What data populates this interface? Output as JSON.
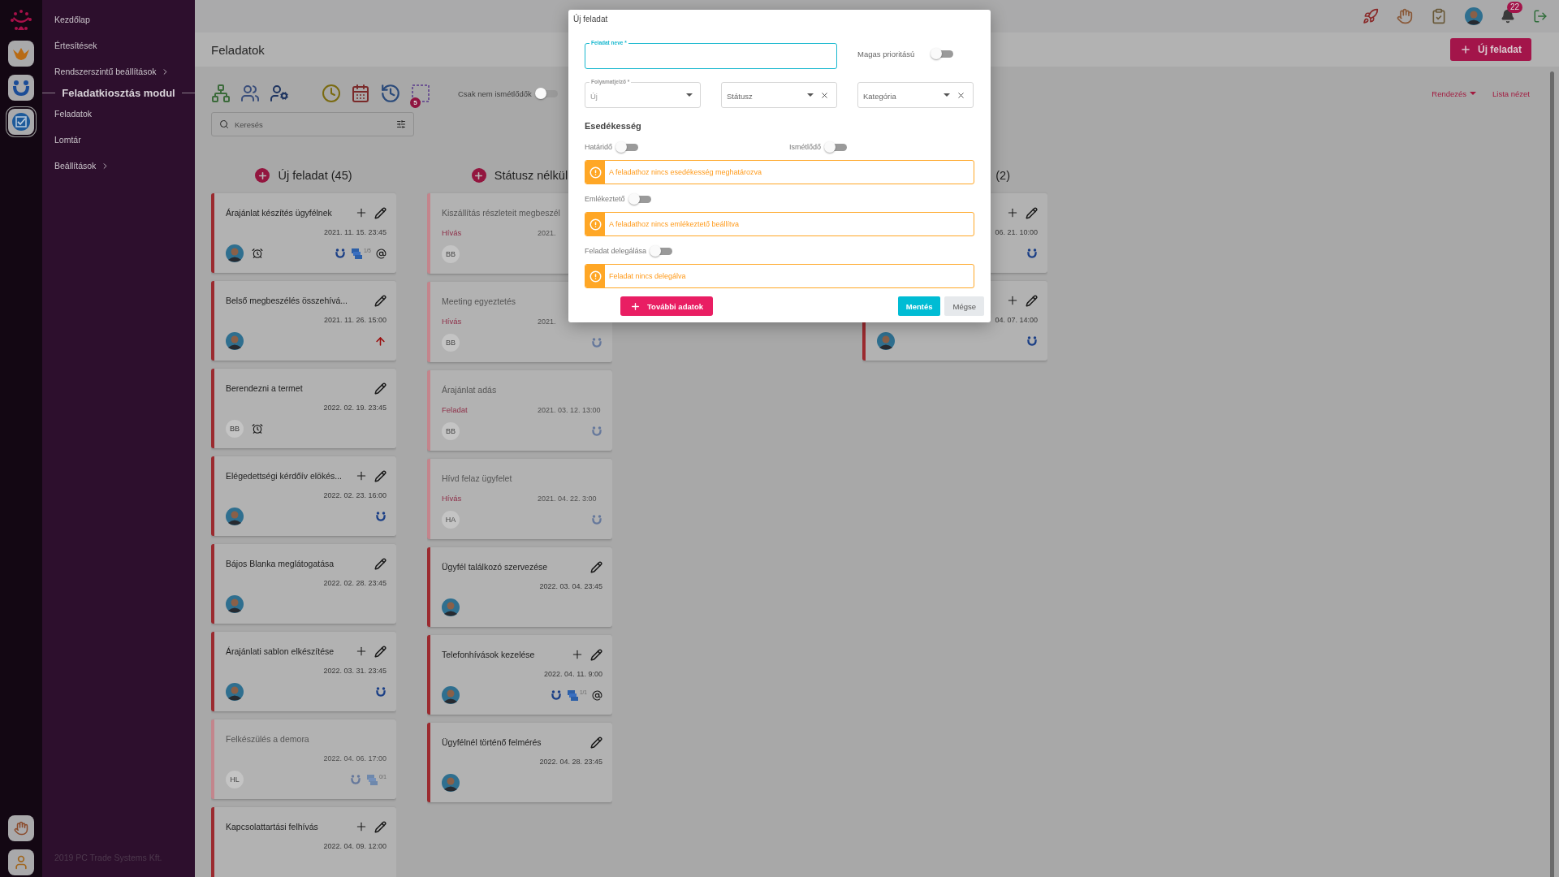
{
  "rail": {
    "apps": [
      {
        "kind": "crown",
        "selected": false
      },
      {
        "kind": "people",
        "selected": false
      },
      {
        "kind": "checkbox",
        "selected": true
      }
    ]
  },
  "sidebar": {
    "items": [
      {
        "kind": "link",
        "label": "Kezdőlap",
        "expandable": false
      },
      {
        "kind": "link",
        "label": "Értesítések",
        "expandable": false
      },
      {
        "kind": "link",
        "label": "Rendszerszintű beállítások",
        "expandable": true
      },
      {
        "kind": "section",
        "label": "Feladatkiosztás modul"
      },
      {
        "kind": "link",
        "label": "Feladatok",
        "expandable": false
      },
      {
        "kind": "link",
        "label": "Lomtár",
        "expandable": false
      },
      {
        "kind": "link",
        "label": "Beállítások",
        "expandable": true
      }
    ],
    "footer": "2019 PC Trade Systems Kft."
  },
  "top_bar": {
    "notification_count": "22"
  },
  "header": {
    "title": "Feladatok",
    "new_button": "Új feladat"
  },
  "filters": {
    "only_non_recurring": {
      "label": "Csak nem ismétlődők",
      "on": false
    },
    "search": {
      "placeholder": "Keresés",
      "filter_count": "5"
    },
    "sort_link": "Rendezés",
    "list_view_link": "Lista nézet"
  },
  "board": {
    "columns": [
      {
        "title": "Új feladat (45)",
        "cards": [
          {
            "title": "Árajánlat készítés ügyfélnek",
            "can_add": true,
            "editable": true,
            "faded": false,
            "date": "2021. 11. 15. 23:45",
            "avatar": {
              "kind": "photo"
            },
            "reminder": true,
            "high_priority": false,
            "badges": [
              {
                "kind": "people"
              },
              {
                "kind": "documents",
                "count": "1/5"
              },
              {
                "kind": "mention"
              }
            ]
          },
          {
            "title": "Belső megbeszélés összehívá...",
            "can_add": false,
            "editable": true,
            "faded": false,
            "date": "2021. 11. 26. 15:00",
            "avatar": {
              "kind": "photo"
            },
            "reminder": false,
            "high_priority": true
          },
          {
            "title": "Berendezni a termet",
            "can_add": false,
            "editable": true,
            "faded": false,
            "date": "2022. 02. 19. 23:45",
            "avatar": {
              "kind": "initials",
              "text": "BB"
            },
            "reminder": true,
            "high_priority": false
          },
          {
            "title": "Elégedettségi kérdőív elökés...",
            "can_add": true,
            "editable": true,
            "faded": false,
            "date": "2022. 02. 23. 16:00",
            "avatar": {
              "kind": "photo"
            },
            "reminder": false,
            "high_priority": false,
            "badges": [
              {
                "kind": "people"
              }
            ]
          },
          {
            "title": "Bájos Blanka meglátogatása",
            "can_add": false,
            "editable": true,
            "faded": false,
            "date": "2022. 02. 28. 23:45",
            "avatar": {
              "kind": "photo"
            },
            "reminder": false,
            "high_priority": false
          },
          {
            "title": "Árajánlati sablon elkészítése",
            "can_add": true,
            "editable": true,
            "faded": false,
            "date": "2022. 03. 31. 23:45",
            "avatar": {
              "kind": "photo"
            },
            "reminder": false,
            "high_priority": false,
            "badges": [
              {
                "kind": "people"
              }
            ]
          },
          {
            "title": "Felkészülés a demora",
            "can_add": false,
            "editable": false,
            "faded": true,
            "date": "2022. 04. 06. 17:00",
            "avatar": {
              "kind": "initials",
              "text": "HL"
            },
            "reminder": false,
            "high_priority": false,
            "badges": [
              {
                "kind": "people"
              },
              {
                "kind": "documents",
                "count": "0/1"
              }
            ]
          },
          {
            "title": "Kapcsolattartási felhívás",
            "can_add": true,
            "editable": true,
            "faded": false,
            "date": "2022. 04. 09. 12:00",
            "reminder": false,
            "high_priority": false
          }
        ]
      },
      {
        "title": "Státusz nélkül",
        "cards": [
          {
            "title": "Kiszállítás részleteit megbeszél",
            "type": "Hívás",
            "can_add": false,
            "editable": false,
            "faded": true,
            "date": "2021.",
            "avatar": {
              "kind": "initials",
              "text": "BB"
            },
            "reminder": false,
            "high_priority": false
          },
          {
            "title": "Meeting egyeztetés",
            "type": "Hívás",
            "can_add": false,
            "editable": false,
            "faded": true,
            "date": "2021.",
            "avatar": {
              "kind": "initials",
              "text": "BB"
            },
            "reminder": false,
            "high_priority": false,
            "badges": [
              {
                "kind": "people"
              }
            ]
          },
          {
            "title": "Árajánlat adás",
            "type": "Feladat",
            "can_add": false,
            "editable": false,
            "faded": true,
            "date": "2021. 03. 12. 13:00",
            "avatar": {
              "kind": "initials",
              "text": "BB"
            },
            "reminder": false,
            "high_priority": false,
            "badges": [
              {
                "kind": "people"
              }
            ]
          },
          {
            "title": "Hívd felaz ügyfelet",
            "type": "Hívás",
            "can_add": false,
            "editable": false,
            "faded": true,
            "date": "2021. 04. 22. 3:00",
            "avatar": {
              "kind": "initials",
              "text": "HA"
            },
            "reminder": false,
            "high_priority": false,
            "badges": [
              {
                "kind": "people"
              }
            ]
          },
          {
            "title": "Ügyfél találkozó szervezése",
            "can_add": false,
            "editable": true,
            "faded": false,
            "date": "2022. 03. 04. 23:45",
            "avatar": {
              "kind": "photo"
            },
            "reminder": false,
            "high_priority": false
          },
          {
            "title": "Telefonhívások kezelése",
            "can_add": true,
            "editable": true,
            "faded": false,
            "date": "2022. 04. 11. 9:00",
            "avatar": {
              "kind": "photo"
            },
            "reminder": false,
            "high_priority": false,
            "badges": [
              {
                "kind": "people"
              },
              {
                "kind": "documents",
                "count": "1/1"
              },
              {
                "kind": "mention"
              }
            ]
          },
          {
            "title": "Ügyfélnél történő felmérés",
            "can_add": false,
            "editable": true,
            "faded": false,
            "date": "2022. 04. 28. 23:45",
            "avatar": {
              "kind": "photo"
            },
            "reminder": false,
            "high_priority": false
          }
        ]
      },
      {
        "title": "(2)",
        "cards": [
          {
            "can_add": true,
            "editable": true,
            "faded": false,
            "date": "06. 21. 10:00",
            "reminder": false,
            "high_priority": false,
            "badges": [
              {
                "kind": "people"
              }
            ]
          },
          {
            "can_add": true,
            "editable": true,
            "faded": false,
            "date": "04. 07. 14:00",
            "avatar": {
              "kind": "photo"
            },
            "reminder": false,
            "high_priority": false,
            "badges": [
              {
                "kind": "people"
              }
            ]
          }
        ]
      }
    ]
  },
  "dialog": {
    "title": "Új feladat",
    "name_field": {
      "label": "Feladat neve *",
      "focused": true
    },
    "high_priority": {
      "label": "Magas prioritású",
      "on": false
    },
    "selects": [
      {
        "label": "Folyamatjelző *",
        "value": "Új",
        "clearable": false
      },
      {
        "placeholder": "Státusz",
        "clearable": true
      },
      {
        "placeholder": "Kategória",
        "clearable": true
      }
    ],
    "section_title": "Esedékesség",
    "rows": [
      {
        "kind": "toggles",
        "toggles": [
          {
            "label": "Határidő",
            "on": false
          },
          {
            "label": "Ismétlődő",
            "on": false
          }
        ]
      },
      {
        "kind": "warning",
        "text": "A feladathoz nincs esedékesség meghatározva"
      },
      {
        "kind": "toggles",
        "toggles": [
          {
            "label": "Emlékeztető",
            "on": false
          }
        ]
      },
      {
        "kind": "warning",
        "text": "A feladathoz nincs emlékeztető beállítva"
      },
      {
        "kind": "toggles",
        "toggles": [
          {
            "label": "Feladat delegálása",
            "on": false
          }
        ]
      },
      {
        "kind": "warning",
        "text": "Feladat nincs delegálva"
      }
    ],
    "more_button": "További adatok",
    "save_button": "Mentés",
    "cancel_button": "Mégse"
  }
}
